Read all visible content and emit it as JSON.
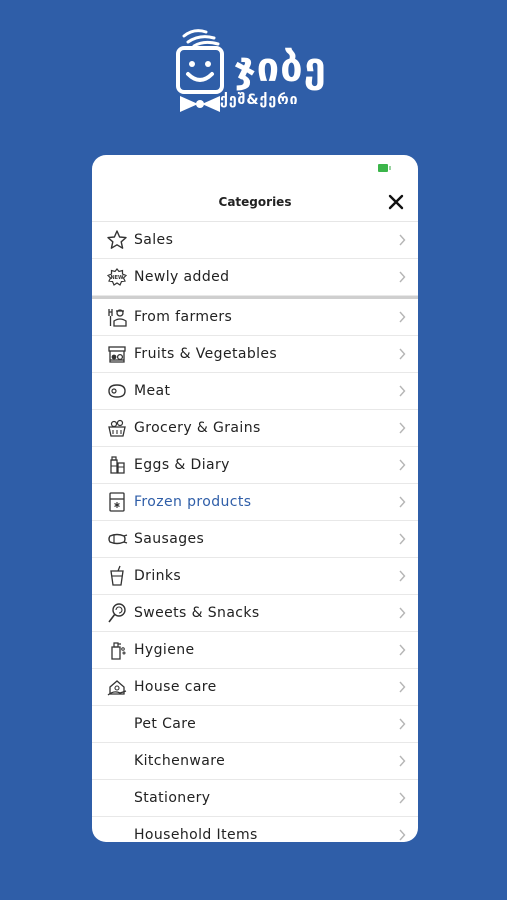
{
  "brand": {
    "name": "ჯიბე",
    "tagline": "ქეშ&ქერი",
    "color": "#2f5ea8"
  },
  "menu": {
    "title": "Categories",
    "close_icon": "close-icon",
    "active_color": "#2f5ea8",
    "top_items": [
      {
        "label": "Sales",
        "icon": "star-icon"
      },
      {
        "label": "Newly added",
        "icon": "new-badge-icon"
      }
    ],
    "items": [
      {
        "label": "From farmers",
        "icon": "farmer-icon"
      },
      {
        "label": "Fruits & Vegetables",
        "icon": "produce-stand-icon"
      },
      {
        "label": "Meat",
        "icon": "meat-icon"
      },
      {
        "label": "Grocery & Grains",
        "icon": "grocery-basket-icon"
      },
      {
        "label": "Eggs & Diary",
        "icon": "milk-bottle-icon"
      },
      {
        "label": "Frozen products",
        "icon": "freezer-icon",
        "active": true
      },
      {
        "label": "Sausages",
        "icon": "sausage-icon"
      },
      {
        "label": "Drinks",
        "icon": "drink-cup-icon"
      },
      {
        "label": "Sweets & Snacks",
        "icon": "lollipop-icon"
      },
      {
        "label": "Hygiene",
        "icon": "soap-bottle-icon"
      },
      {
        "label": "House care",
        "icon": "house-care-icon"
      },
      {
        "label": "Pet Care",
        "icon": ""
      },
      {
        "label": "Kitchenware",
        "icon": ""
      },
      {
        "label": "Stationery",
        "icon": ""
      },
      {
        "label": "Household Items",
        "icon": ""
      }
    ]
  }
}
